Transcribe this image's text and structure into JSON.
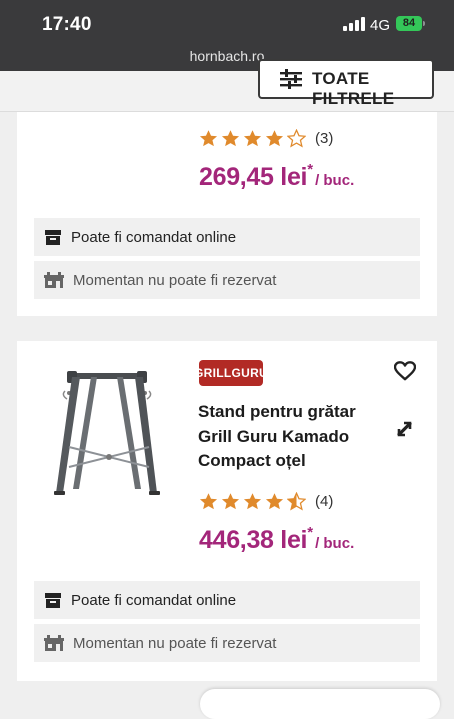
{
  "status_bar": {
    "time": "17:40",
    "network": "4G",
    "battery": "84"
  },
  "browser": {
    "url": "hornbach.ro"
  },
  "filters": {
    "label": "TOATE FILTRELE"
  },
  "products": [
    {
      "rating_stars": 4,
      "rating_count": "(3)",
      "price": "269,45 lei",
      "price_marker": "*",
      "price_unit": "/ buc.",
      "availability_online": "Poate fi comandat online",
      "availability_reserve": "Momentan nu poate fi rezervat"
    },
    {
      "brand": "GRILLGURU",
      "title": "Stand pentru grătar Grill Guru Kamado Compact oțel",
      "rating_stars": 4.5,
      "rating_count": "(4)",
      "price": "446,38 lei",
      "price_marker": "*",
      "price_unit": "/ buc.",
      "availability_online": "Poate fi comandat online",
      "availability_reserve": "Momentan nu poate fi rezervat"
    }
  ],
  "colors": {
    "price": "#a3267a",
    "star": "#e08a2c",
    "brand_badge": "#b22a25",
    "status_bar": "#3a3a3c",
    "battery": "#34c759"
  },
  "icons": [
    "filter-sliders-icon",
    "box-icon",
    "store-icon",
    "heart-icon",
    "compare-arrows-icon",
    "star-icon"
  ]
}
